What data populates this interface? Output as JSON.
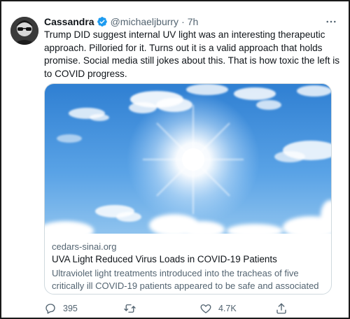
{
  "tweet": {
    "author": {
      "display_name": "Cassandra",
      "handle": "@michaeljburry",
      "separator": "·",
      "time": "7h",
      "verified": true
    },
    "text": "Trump DID suggest internal UV light was an interesting therapeutic approach. Pilloried for it. Turns out it is a valid approach that holds promise. Social media still jokes about this. That is how toxic the left is to COVID progress.",
    "card": {
      "domain": "cedars-sinai.org",
      "title": "UVA Light Reduced Virus Loads in COVID-19 Patients",
      "description": "Ultraviolet light treatments introduced into the tracheas of five critically ill COVID-19 patients appeared to be safe and associated with a ..."
    },
    "actions": {
      "reply_count": "395",
      "retweet_count": "",
      "like_count": "4.7K"
    }
  },
  "icons": {
    "verified": "verified-badge-icon",
    "more": "more-dots-icon",
    "reply": "reply-icon",
    "retweet": "retweet-icon",
    "like": "heart-icon",
    "share": "share-icon"
  },
  "colors": {
    "verified_blue": "#1d9bf0",
    "text_primary": "#0f1419",
    "text_secondary": "#536471",
    "card_border": "#cfd9de",
    "sky_top": "#2f7fd2",
    "sky_bottom": "#8fc3ee"
  }
}
